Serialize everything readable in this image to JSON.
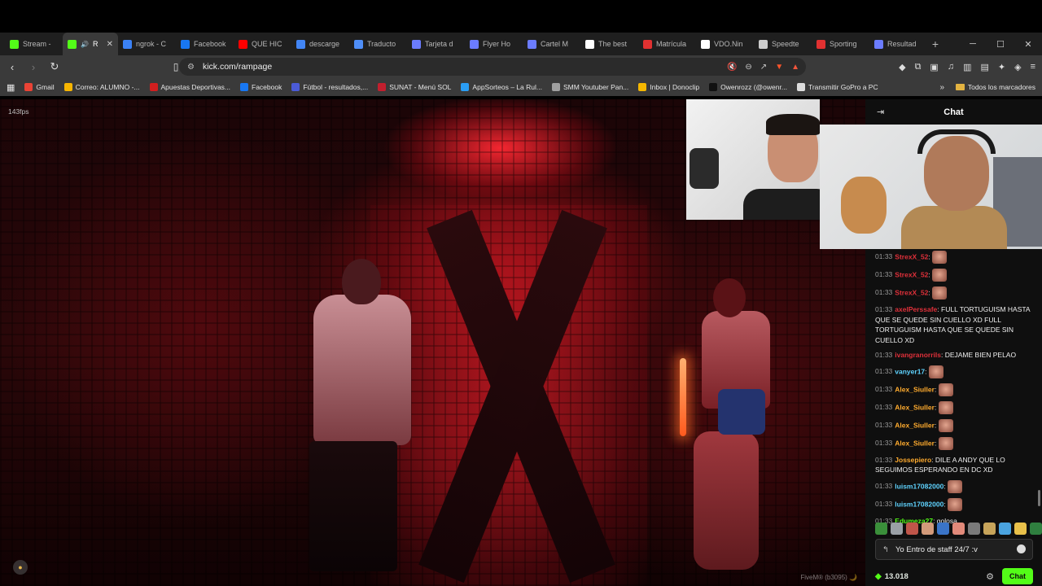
{
  "browser": {
    "tabs": [
      {
        "label": "Stream -",
        "fav": "#53fc18",
        "active": false
      },
      {
        "label": "R",
        "fav": "#53fc18",
        "active": true
      },
      {
        "label": "ngrok - C",
        "fav": "#3b82f6",
        "active": false
      },
      {
        "label": "Facebook",
        "fav": "#1877f2",
        "active": false
      },
      {
        "label": "QUE HIC",
        "fav": "#ff0000",
        "active": false
      },
      {
        "label": "descarge",
        "fav": "#4285f4",
        "active": false
      },
      {
        "label": "Traducto",
        "fav": "#4f8ef7",
        "active": false
      },
      {
        "label": "Tarjeta d",
        "fav": "#6b7cff",
        "active": false
      },
      {
        "label": "Flyer Ho",
        "fav": "#6b7cff",
        "active": false
      },
      {
        "label": "Cartel M",
        "fav": "#6b7cff",
        "active": false
      },
      {
        "label": "The best",
        "fav": "#ffffff",
        "active": false
      },
      {
        "label": "Matrícula",
        "fav": "#e03131",
        "active": false
      },
      {
        "label": "VDO.Nin",
        "fav": "#ffffff",
        "active": false
      },
      {
        "label": "Speedte",
        "fav": "#cccccc",
        "active": false
      },
      {
        "label": "Sporting",
        "fav": "#e03131",
        "active": false
      },
      {
        "label": "Resultad",
        "fav": "#6b7cff",
        "active": false
      }
    ],
    "new_tab": "+",
    "url": "kick.com/rampage",
    "bookmarks": [
      {
        "label": "Gmail",
        "fav": "#ea4335"
      },
      {
        "label": "Correo: ALUMNO -...",
        "fav": "#f7b500"
      },
      {
        "label": "Apuestas Deportivas...",
        "fav": "#d11f1f"
      },
      {
        "label": "Facebook",
        "fav": "#1877f2"
      },
      {
        "label": "Fútbol - resultados,...",
        "fav": "#4b5bd8"
      },
      {
        "label": "SUNAT - Menú SOL",
        "fav": "#c21f2e"
      },
      {
        "label": "AppSorteos – La Rul...",
        "fav": "#2a9df4"
      },
      {
        "label": "SMM Youtuber Pan...",
        "fav": "#a0a0a0"
      },
      {
        "label": "Inbox | Donoclip",
        "fav": "#f5b700"
      },
      {
        "label": "Owenrozz (@owenr...",
        "fav": "#111111"
      },
      {
        "label": "Transmitir GoPro a PC",
        "fav": "#dddddd"
      }
    ],
    "bookmarks_more": "»",
    "all_bookmarks": "Todos los marcadores"
  },
  "stream": {
    "fps": "143fps",
    "watermark": "FiveM® (b3095) 🌙"
  },
  "chat": {
    "title": "Chat",
    "messages": [
      {
        "ts": "01:33",
        "user": "StrexX_52",
        "color": "#e0303a",
        "text": "",
        "emote": true
      },
      {
        "ts": "01:33",
        "user": "StrexX_52",
        "color": "#e0303a",
        "text": "",
        "emote": true
      },
      {
        "ts": "01:33",
        "user": "StrexX_52",
        "color": "#e0303a",
        "text": "",
        "emote": true
      },
      {
        "ts": "01:33",
        "user": "axelPerssafe",
        "color": "#e0303a",
        "text": "FULL TORTUGUISM HASTA QUE SE QUEDE SIN CUELLO XD FULL TORTUGUISM HASTA QUE SE QUEDE SIN CUELLO XD",
        "emote": false
      },
      {
        "ts": "01:33",
        "user": "ivangranorrils",
        "color": "#e0303a",
        "text": "DEJAME BIEN PELAO",
        "emote": false
      },
      {
        "ts": "01:33",
        "user": "vanyer17",
        "color": "#5fd3ff",
        "text": "",
        "emote": true
      },
      {
        "ts": "01:33",
        "user": "Alex_Siuller",
        "color": "#ffab2e",
        "text": "",
        "emote": true
      },
      {
        "ts": "01:33",
        "user": "Alex_Siuller",
        "color": "#ffab2e",
        "text": "",
        "emote": true
      },
      {
        "ts": "01:33",
        "user": "Alex_Siuller",
        "color": "#ffab2e",
        "text": "",
        "emote": true
      },
      {
        "ts": "01:33",
        "user": "Alex_Siuller",
        "color": "#ffab2e",
        "text": "",
        "emote": true
      },
      {
        "ts": "01:33",
        "user": "Jossepiero",
        "color": "#ffab2e",
        "text": "DILE A ANDY QUE LO SEGUIMOS ESPERANDO EN DC XD",
        "emote": false
      },
      {
        "ts": "01:33",
        "user": "luism17082000",
        "color": "#5fd3ff",
        "text": "",
        "emote": true
      },
      {
        "ts": "01:33",
        "user": "luism17082000",
        "color": "#5fd3ff",
        "text": "",
        "emote": true
      },
      {
        "ts": "01:33",
        "user": "Edumeza27",
        "color": "#53fc18",
        "text": "golosa",
        "emote": false
      }
    ],
    "input_value": "Yo Entro de staff 24/7 :v",
    "points": "13.018",
    "send_label": "Chat",
    "emote_colors": [
      "#3a8f3a",
      "#9aa0a6",
      "#c0564a",
      "#d39a7a",
      "#3a74c8",
      "#e28a7a",
      "#7a7a7a",
      "#c7a45a",
      "#4aa3df",
      "#e8c04a",
      "#2f7f3f",
      "#e8e8e8",
      "#e8b94a"
    ]
  }
}
